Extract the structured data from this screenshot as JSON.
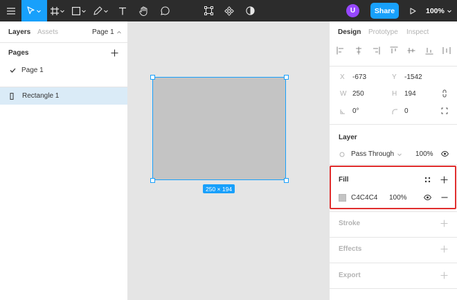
{
  "toolbar": {
    "avatar_initial": "U",
    "share_label": "Share",
    "zoom": "100%"
  },
  "left_panel": {
    "tabs": [
      "Layers",
      "Assets"
    ],
    "page_selector": "Page 1",
    "pages_heading": "Pages",
    "pages": [
      {
        "label": "Page 1",
        "selected": true
      }
    ],
    "layers": [
      {
        "label": "Rectangle 1",
        "type": "rectangle",
        "selected": true
      }
    ]
  },
  "canvas": {
    "selection_size_label": "250 × 194",
    "shape_fill": "#C4C4C4",
    "selection_color": "#18A0FB"
  },
  "right_panel": {
    "tabs": [
      "Design",
      "Prototype",
      "Inspect"
    ],
    "properties": {
      "x_label": "X",
      "x": "-673",
      "y_label": "Y",
      "y": "-1542",
      "w_label": "W",
      "w": "250",
      "h_label": "H",
      "h": "194",
      "rotation": "0°",
      "corner_radius": "0"
    },
    "layer": {
      "title": "Layer",
      "blend_mode": "Pass Through",
      "opacity": "100%"
    },
    "fill": {
      "title": "Fill",
      "hex": "C4C4C4",
      "opacity": "100%",
      "swatch_color": "#C4C4C4"
    },
    "stroke_title": "Stroke",
    "effects_title": "Effects",
    "export_title": "Export"
  },
  "colors": {
    "accent": "#18A0FB",
    "toolbar_bg": "#2C2C2C",
    "avatar": "#9747FF",
    "highlight": "#E02D2D"
  }
}
